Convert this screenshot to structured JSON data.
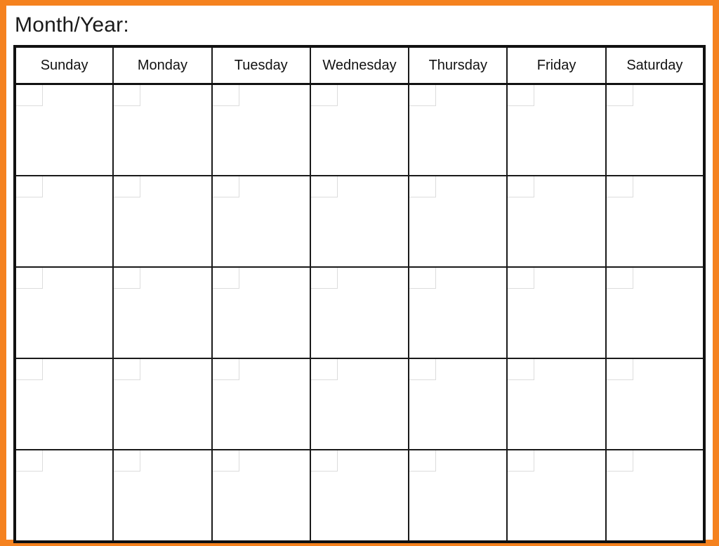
{
  "page": {
    "title": "Month/Year:",
    "frame_color": "#f5821f",
    "grid_color": "#1a1a1a",
    "outer_border_color": "#111111",
    "date_box_border_color": "#dcdcdc",
    "background_color": "#ffffff"
  },
  "calendar": {
    "weekday_headers": [
      "Sunday",
      "Monday",
      "Tuesday",
      "Wednesday",
      "Thursday",
      "Friday",
      "Saturday"
    ],
    "week_count": 5,
    "weeks": [
      {
        "days": [
          "",
          "",
          "",
          "",
          "",
          "",
          ""
        ]
      },
      {
        "days": [
          "",
          "",
          "",
          "",
          "",
          "",
          ""
        ]
      },
      {
        "days": [
          "",
          "",
          "",
          "",
          "",
          "",
          ""
        ]
      },
      {
        "days": [
          "",
          "",
          "",
          "",
          "",
          "",
          ""
        ]
      },
      {
        "days": [
          "",
          "",
          "",
          "",
          "",
          "",
          ""
        ]
      }
    ]
  },
  "watermark": {
    "text": ""
  }
}
